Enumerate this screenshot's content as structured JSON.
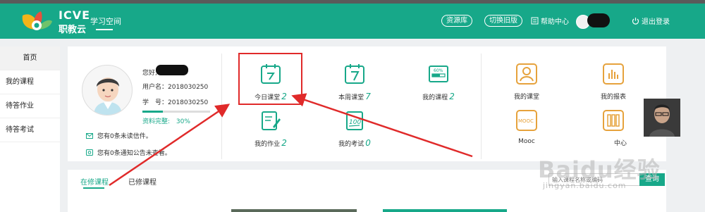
{
  "header": {
    "brand_en": "ICVE",
    "brand_cn": "职教云",
    "space_title": "学习空间",
    "resource_label": "资源库",
    "switch_label": "切换旧版",
    "help_label": "帮助中心",
    "logout_label": "退出登录",
    "colors": {
      "bg": "#17a889",
      "topline": "#5a5a5a"
    }
  },
  "sidebar": {
    "items": [
      {
        "label": "首页"
      },
      {
        "label": "我的课程"
      },
      {
        "label": "待答作业"
      },
      {
        "label": "待答考试"
      }
    ]
  },
  "profile": {
    "greeting": "您好,",
    "username_line": "用户名：2018030250",
    "student_id_line": "学　号：2018030250",
    "complete_label": "资料完整:",
    "complete_value": "30%",
    "complete_fraction": 0.3,
    "mail_msg": "您有0条未读信件。",
    "notice_msg": "您有0条通知公告未查看。"
  },
  "tiles": [
    {
      "label": "今日课堂",
      "count": "2",
      "icon": "today-class-icon"
    },
    {
      "label": "本周课堂",
      "count": "7",
      "icon": "week-class-icon"
    },
    {
      "label": "我的课程",
      "count": "2",
      "icon": "my-course-icon"
    },
    {
      "label": "我的作业",
      "count": "2",
      "icon": "my-homework-icon"
    },
    {
      "label": "我的考试",
      "count": "0",
      "icon": "my-exam-icon"
    }
  ],
  "right_tiles": [
    {
      "label": "我的课堂",
      "icon": "person-icon"
    },
    {
      "label": "我的报表",
      "icon": "report-icon"
    },
    {
      "label": "Mooc",
      "icon": "mooc-icon"
    },
    {
      "label": "中心",
      "icon": "book-icon"
    }
  ],
  "courses": {
    "tab_active": "在修课程",
    "tab_other": "已修课程",
    "search_placeholder": "输入课程名称或编码",
    "search_button": "查询"
  },
  "watermark": {
    "main": "Baidu经验",
    "sub": "jingyan.baidu.com"
  }
}
